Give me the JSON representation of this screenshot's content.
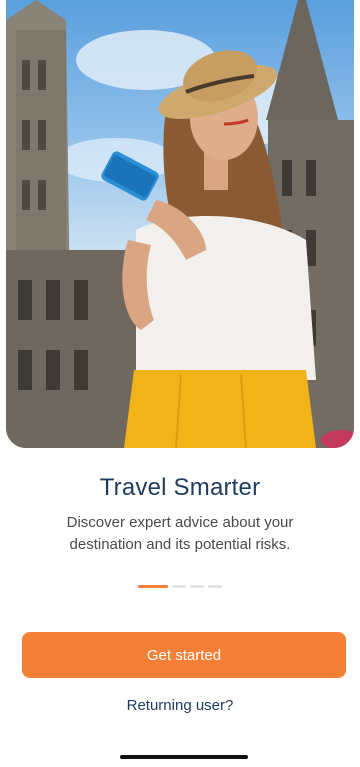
{
  "hero": {
    "image_alt": "Woman in straw hat holding a phone in front of a gothic building",
    "icon": "hero-photo"
  },
  "onboarding": {
    "title": "Travel Smarter",
    "subtitle": "Discover expert advice about your destination and its potential risks.",
    "page_indicator": {
      "total": 4,
      "active": 1
    }
  },
  "actions": {
    "primary_label": "Get started",
    "secondary_label": "Returning user?"
  },
  "colors": {
    "accent": "#f47f36",
    "title": "#1e3a5f",
    "text": "#4a4a4a",
    "indicator_inactive": "#e3e3e3"
  }
}
